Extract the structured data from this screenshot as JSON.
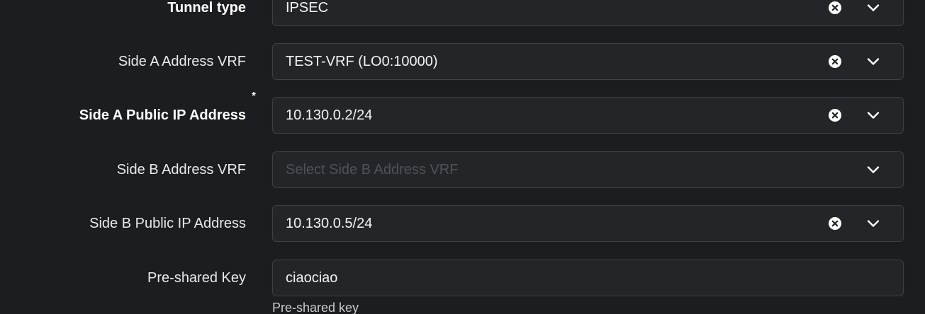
{
  "form": {
    "tunnel_type": {
      "label": "Tunnel type",
      "required": "*",
      "value": "IPSEC"
    },
    "side_a_vrf": {
      "label": "Side A Address VRF",
      "value": "TEST-VRF (LO0:10000)"
    },
    "side_a_ip": {
      "label": "Side A Public IP Address",
      "required": "*",
      "value": "10.130.0.2/24"
    },
    "side_b_vrf": {
      "label": "Side B Address VRF",
      "placeholder": "Select Side B Address VRF"
    },
    "side_b_ip": {
      "label": "Side B Public IP Address",
      "value": "10.130.0.5/24"
    },
    "psk": {
      "label": "Pre-shared Key",
      "value": "ciaociao",
      "help": "Pre-shared key"
    }
  },
  "icons": {
    "clear": "clear-circle-x-icon",
    "dropdown": "chevron-down-icon"
  },
  "colors": {
    "background": "#1b1d20",
    "field_background": "#232529",
    "field_border": "#3c3f44",
    "text": "#f2f3f4",
    "placeholder": "#4e5257"
  }
}
